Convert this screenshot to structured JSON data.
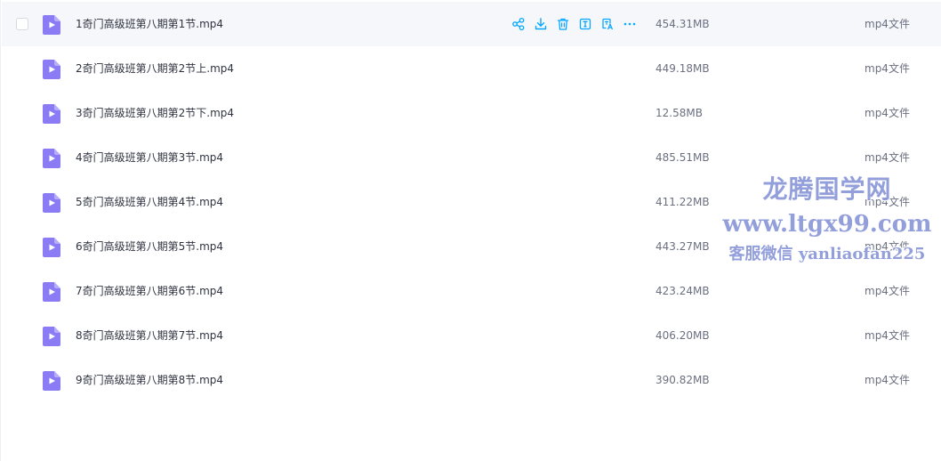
{
  "files": [
    {
      "name": "1奇门高级班第八期第1节.mp4",
      "size": "454.31MB",
      "type": "mp4文件"
    },
    {
      "name": "2奇门高级班第八期第2节上.mp4",
      "size": "449.18MB",
      "type": "mp4文件"
    },
    {
      "name": "3奇门高级班第八期第2节下.mp4",
      "size": "12.58MB",
      "type": "mp4文件"
    },
    {
      "name": "4奇门高级班第八期第3节.mp4",
      "size": "485.51MB",
      "type": "mp4文件"
    },
    {
      "name": "5奇门高级班第八期第4节.mp4",
      "size": "411.22MB",
      "type": "mp4文件"
    },
    {
      "name": "6奇门高级班第八期第5节.mp4",
      "size": "443.27MB",
      "type": "mp4文件"
    },
    {
      "name": "7奇门高级班第八期第6节.mp4",
      "size": "423.24MB",
      "type": "mp4文件"
    },
    {
      "name": "8奇门高级班第八期第7节.mp4",
      "size": "406.20MB",
      "type": "mp4文件"
    },
    {
      "name": "9奇门高级班第八期第8节.mp4",
      "size": "390.82MB",
      "type": "mp4文件"
    }
  ],
  "hovered_row_actions": [
    "share-icon",
    "download-icon",
    "delete-icon",
    "text-icon",
    "translate-icon",
    "more-icon"
  ],
  "watermark": {
    "line1": "龙腾国学网",
    "line2": "www.ltgx99.com",
    "line3": "客服微信 yanliaofan225"
  },
  "colors": {
    "accent": "#06a7ff",
    "file_icon": "#8b7cf6",
    "row_hover": "#f6f7fb",
    "watermark": "#8a97d8"
  }
}
